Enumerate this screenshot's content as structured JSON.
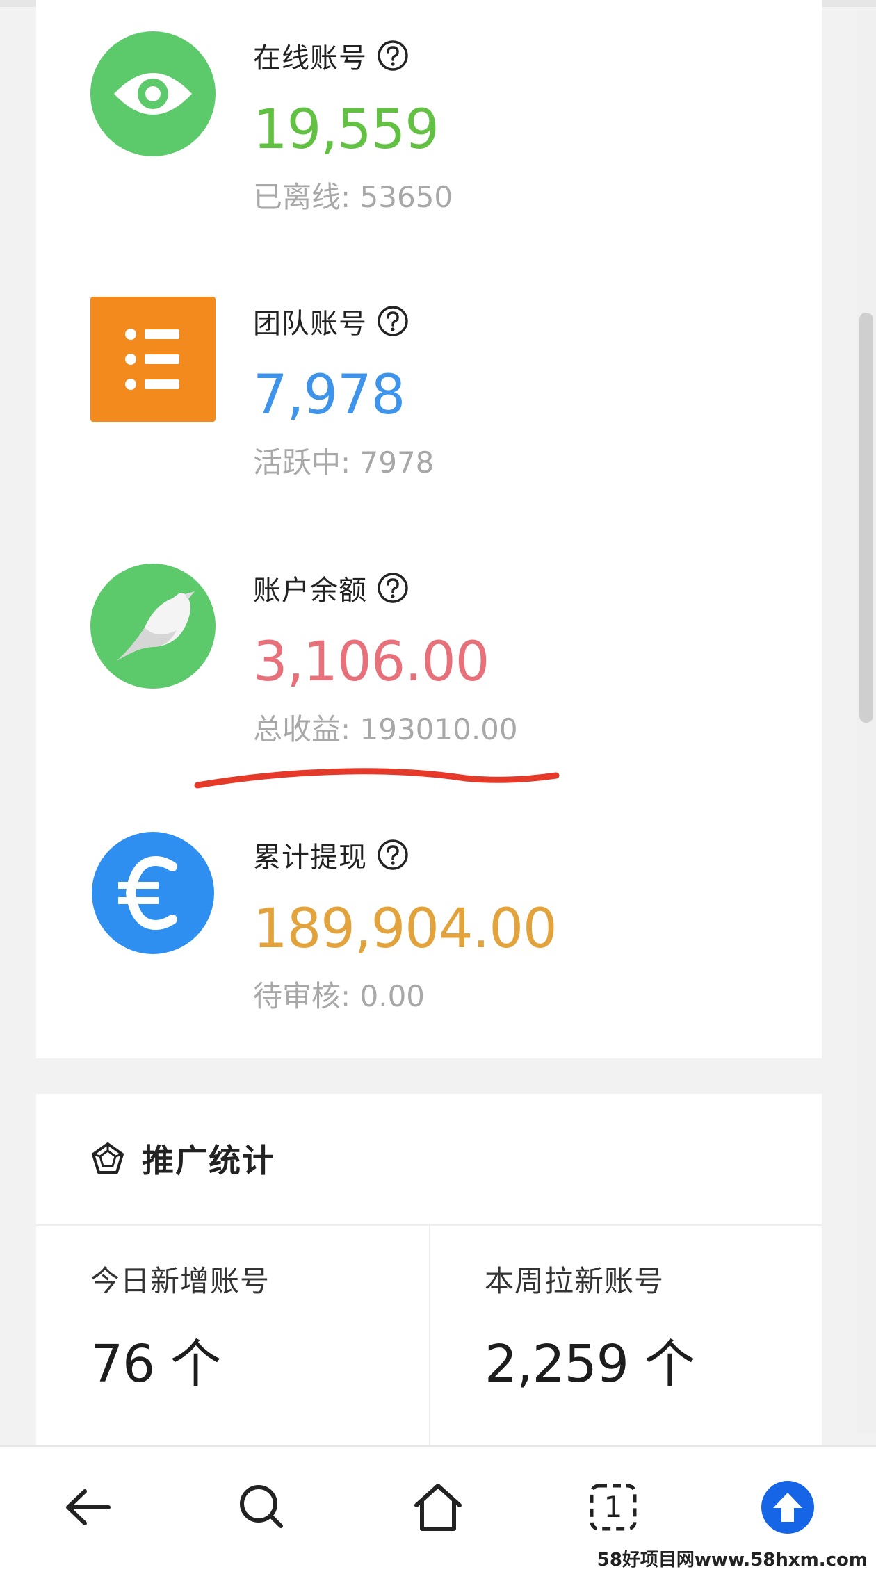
{
  "stats": [
    {
      "title": "在线账号",
      "value": "19,559",
      "sub": "已离线: 53650",
      "color": "#62c143",
      "icon": "eye-icon",
      "icon_bg": "#5cc96b"
    },
    {
      "title": "团队账号",
      "value": "7,978",
      "sub": "活跃中: 7978",
      "color": "#3d94ea",
      "icon": "list-icon",
      "icon_bg": "#f38a1e"
    },
    {
      "title": "账户余额",
      "value": "3,106.00",
      "sub": "总收益: 193010.00",
      "color": "#e8707a",
      "icon": "bird-icon",
      "icon_bg": "#5cc96b"
    },
    {
      "title": "累计提现",
      "value": "189,904.00",
      "sub": "待审核: 0.00",
      "color": "#e2a23c",
      "icon": "euro-icon",
      "icon_bg": "#2e8ff0"
    }
  ],
  "promo": {
    "title": "推广统计",
    "icon": "pentagon-icon",
    "cells": [
      {
        "label": "今日新增账号",
        "value": "76 个"
      },
      {
        "label": "本周拉新账号",
        "value": "2,259 个"
      }
    ]
  },
  "nav": {
    "items": [
      "back-arrow-icon",
      "search-icon",
      "home-icon",
      "tabs-icon",
      "upload-icon"
    ],
    "tab_count": "1"
  },
  "watermark": "58好项目网www.58hxm.com"
}
